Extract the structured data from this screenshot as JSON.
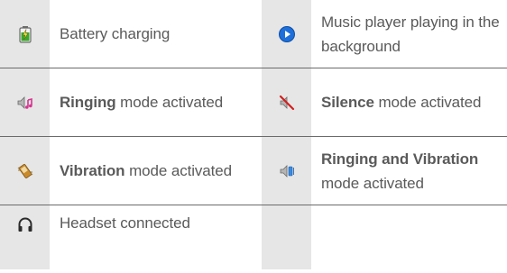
{
  "rows": [
    {
      "left": {
        "icon": "battery-charging-icon",
        "text_lead": "",
        "text_rest": "Battery charging"
      },
      "right": {
        "icon": "music-playing-icon",
        "text_lead": "",
        "text_rest": "Music player playing in the background"
      }
    },
    {
      "left": {
        "icon": "ringing-mode-icon",
        "text_lead": "Ringing",
        "text_rest": " mode activated"
      },
      "right": {
        "icon": "silence-mode-icon",
        "text_lead": "Silence",
        "text_rest": " mode activated"
      }
    },
    {
      "left": {
        "icon": "vibration-mode-icon",
        "text_lead": "Vibration",
        "text_rest": " mode activated"
      },
      "right": {
        "icon": "ringing-and-vibration-icon",
        "text_lead": "Ringing and Vibration",
        "text_rest": " mode activated"
      }
    },
    {
      "left": {
        "icon": "headset-icon",
        "text_lead": "",
        "text_rest": "Headset connected"
      }
    }
  ],
  "colors": {
    "icon_background": "#e6e6e6",
    "text": "#5a5a5a",
    "rule": "#6b6b6b",
    "music_blue": "#1e6fd9",
    "ringing_pink": "#d6338f",
    "silence_red": "#d11f1f",
    "battery_green": "#3aa82a"
  }
}
